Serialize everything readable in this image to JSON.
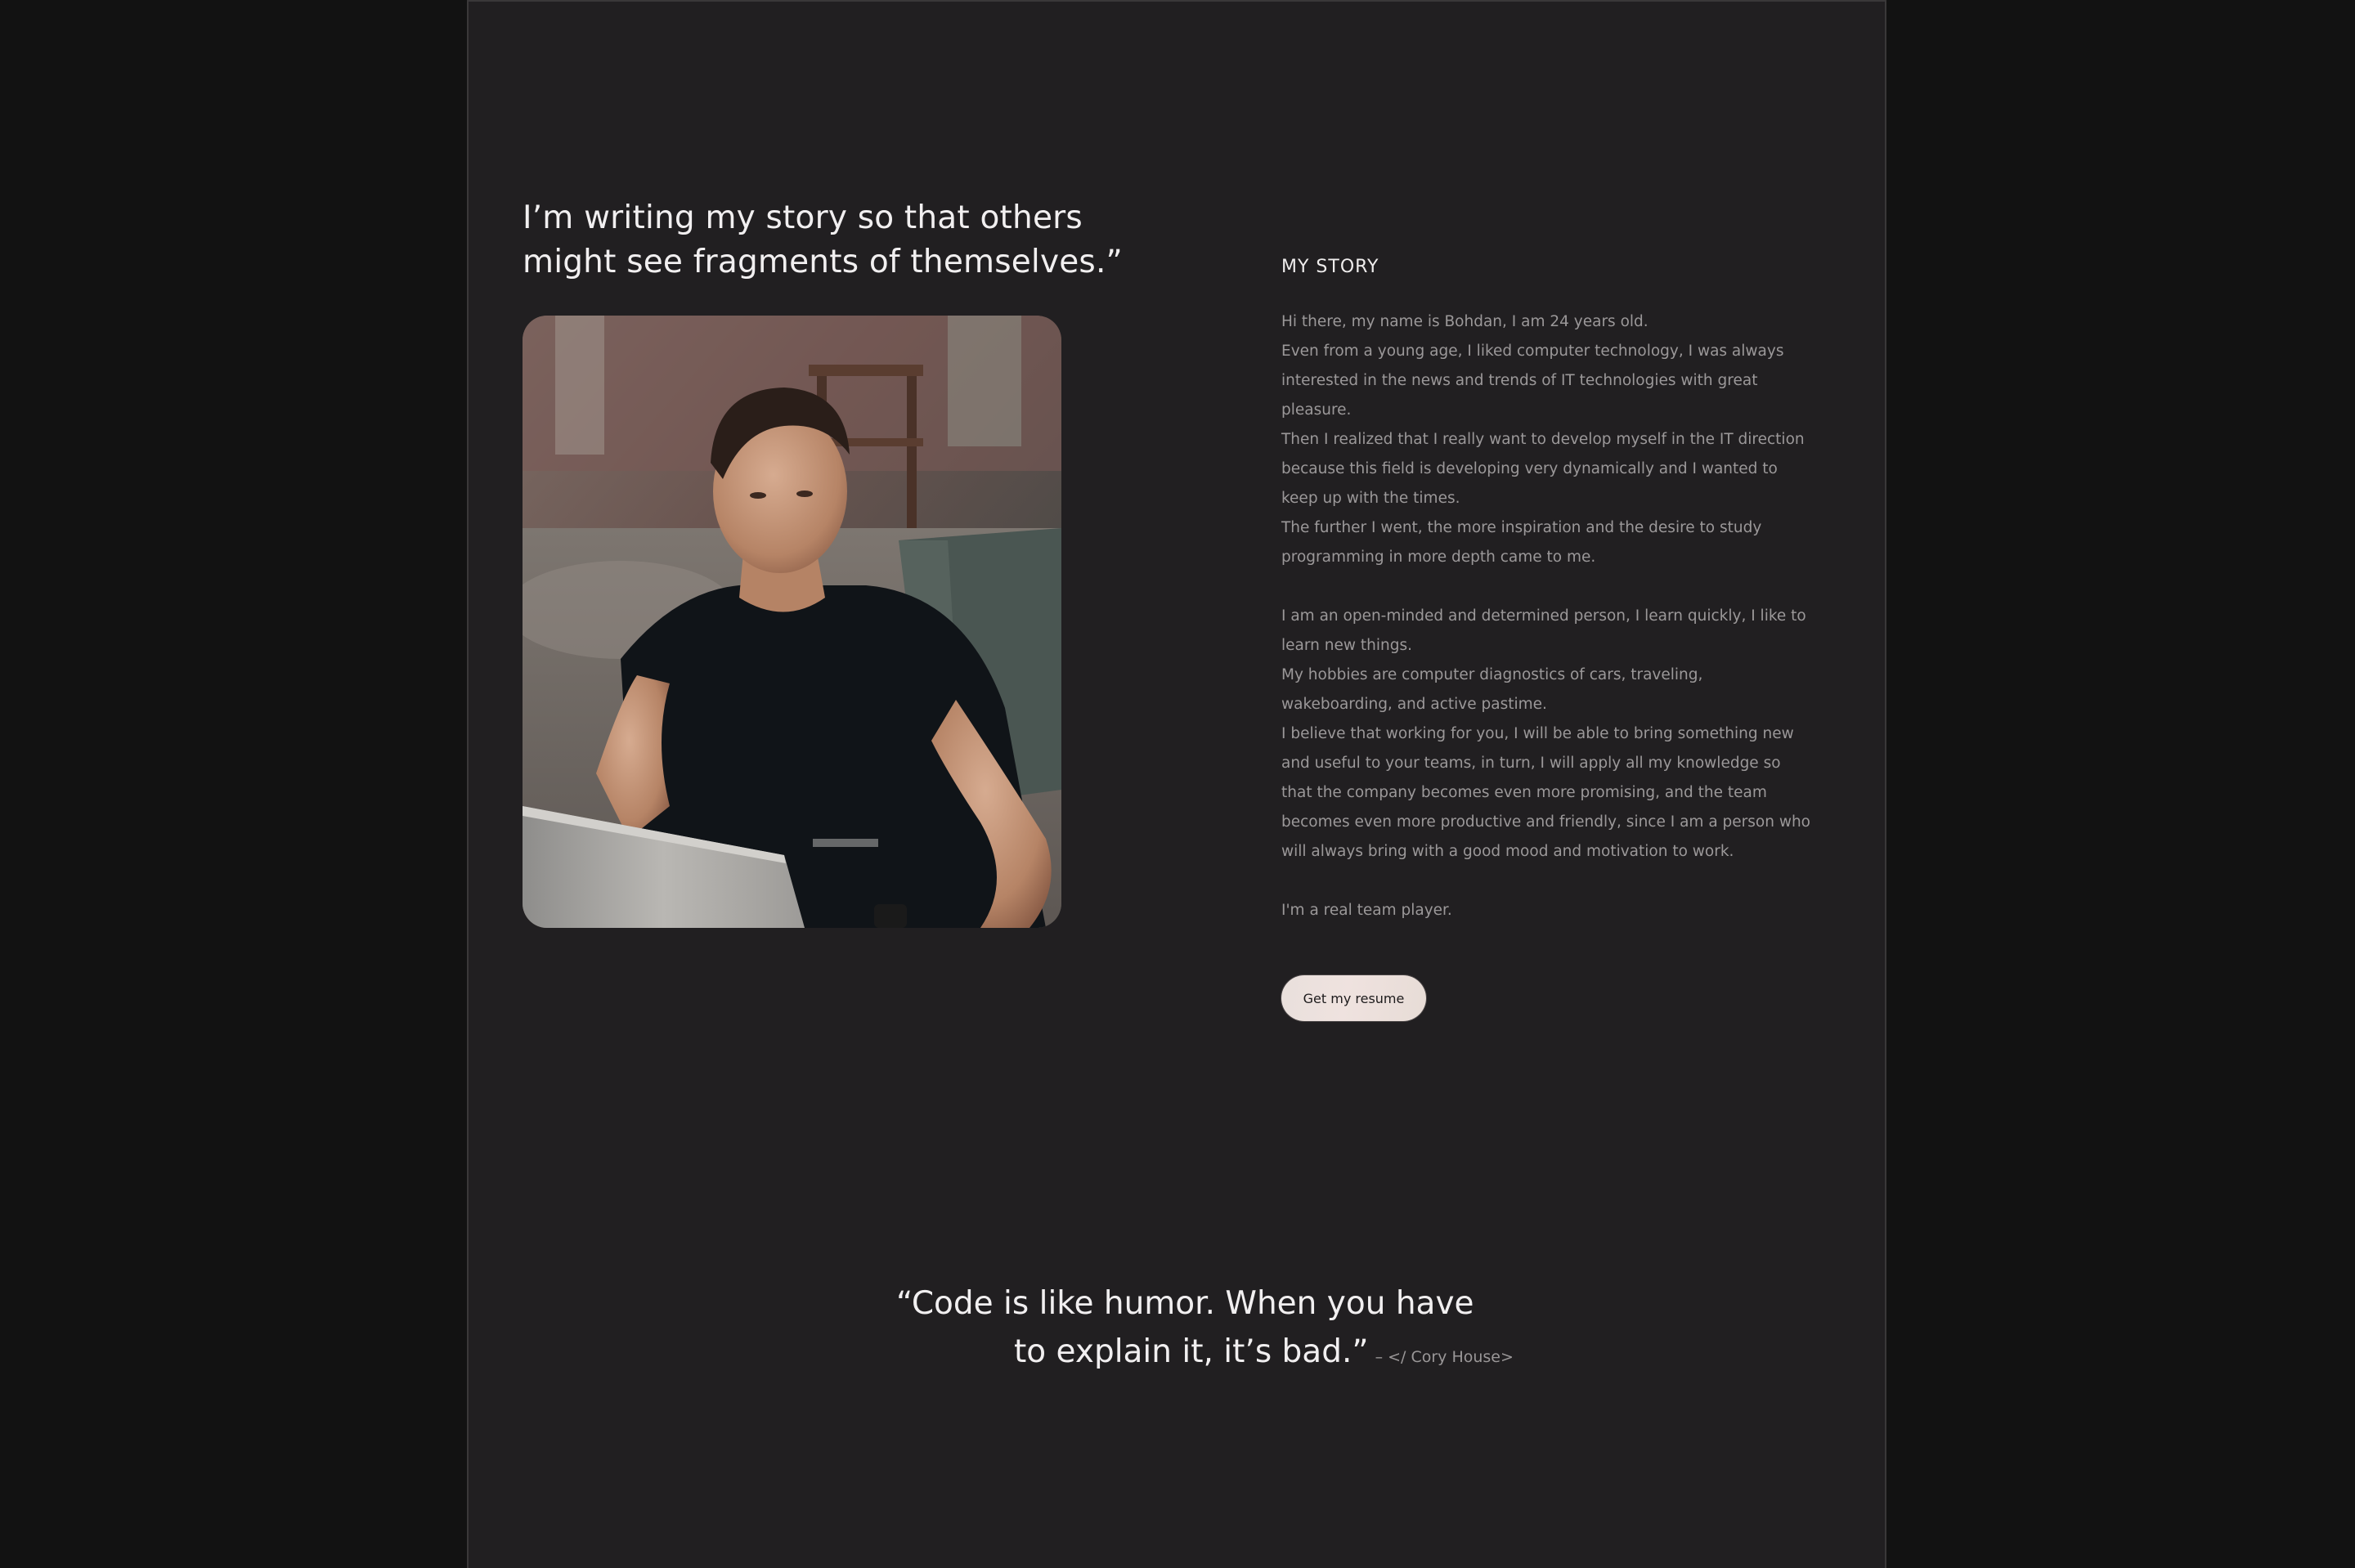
{
  "about": {
    "headline_line1": "I’m writing my story so that others",
    "headline_line2": "might see fragments of themselves.”",
    "photo_alt": "Portrait of Bohdan sitting at a laptop"
  },
  "story": {
    "title": "MY STORY",
    "paragraphs_1": [
      "Hi there, my name is Bohdan, I am 24 years old.",
      "Even from a young age, I liked computer technology, I was always interested in the news and trends of IT technologies with great pleasure.",
      "Then I realized that I really want to develop myself in the IT direction because this field is developing very dynamically and I wanted to keep up with the times.",
      "The further I went, the more inspiration and the desire to study programming in more depth came to me."
    ],
    "paragraphs_2": [
      "I am an open-minded and determined person, I learn quickly, I like to learn new things.",
      "My hobbies are computer diagnostics of cars, traveling, wakeboarding, and active pastime.",
      "I believe that working for you, I will be able to bring something new and useful to your teams, in turn, I will apply all my knowledge so that the company becomes even more promising, and the team becomes even more productive and friendly, since I am a person who will always bring with a good mood and motivation to work."
    ],
    "closing": "I'm a real team player.",
    "button_label": "Get my resume"
  },
  "quote": {
    "line1": "“Code is like humor. When you have",
    "line2": "to explain it, it’s bad.”",
    "author": "– </ Cory House>"
  },
  "colors": {
    "page_bg": "#121212",
    "frame_bg": "#211f21",
    "text_primary": "#f1eff0",
    "text_muted": "#9b9899",
    "button_bg": "#ebe1dd"
  }
}
